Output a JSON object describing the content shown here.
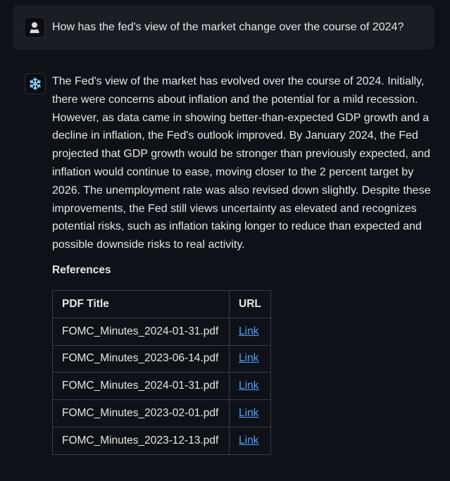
{
  "user_message": {
    "avatar_icon": "user-avatar-icon",
    "text": "How has the fed's view of the market change over the course of 2024?"
  },
  "assistant_message": {
    "avatar_icon": "snowflake-icon",
    "text": "The Fed's view of the market has evolved over the course of 2024. Initially, there were concerns about inflation and the potential for a mild recession. However, as data came in showing better-than-expected GDP growth and a decline in inflation, the Fed's outlook improved. By January 2024, the Fed projected that GDP growth would be stronger than previously expected, and inflation would continue to ease, moving closer to the 2 percent target by 2026. The unemployment rate was also revised down slightly. Despite these improvements, the Fed still views uncertainty as elevated and recognizes potential risks, such as inflation taking longer to reduce than expected and possible downside risks to real activity.",
    "references": {
      "heading": "References",
      "columns": [
        "PDF Title",
        "URL"
      ],
      "rows": [
        {
          "title": "FOMC_Minutes_2024-01-31.pdf",
          "url_label": "Link"
        },
        {
          "title": "FOMC_Minutes_2023-06-14.pdf",
          "url_label": "Link"
        },
        {
          "title": "FOMC_Minutes_2024-01-31.pdf",
          "url_label": "Link"
        },
        {
          "title": "FOMC_Minutes_2023-02-01.pdf",
          "url_label": "Link"
        },
        {
          "title": "FOMC_Minutes_2023-12-13.pdf",
          "url_label": "Link"
        }
      ]
    }
  },
  "colors": {
    "background": "#0e1117",
    "user_bubble": "#1a1d24",
    "text": "#e6e6e6",
    "link": "#4ea3ff",
    "snowflake": "#8fd3ff"
  }
}
